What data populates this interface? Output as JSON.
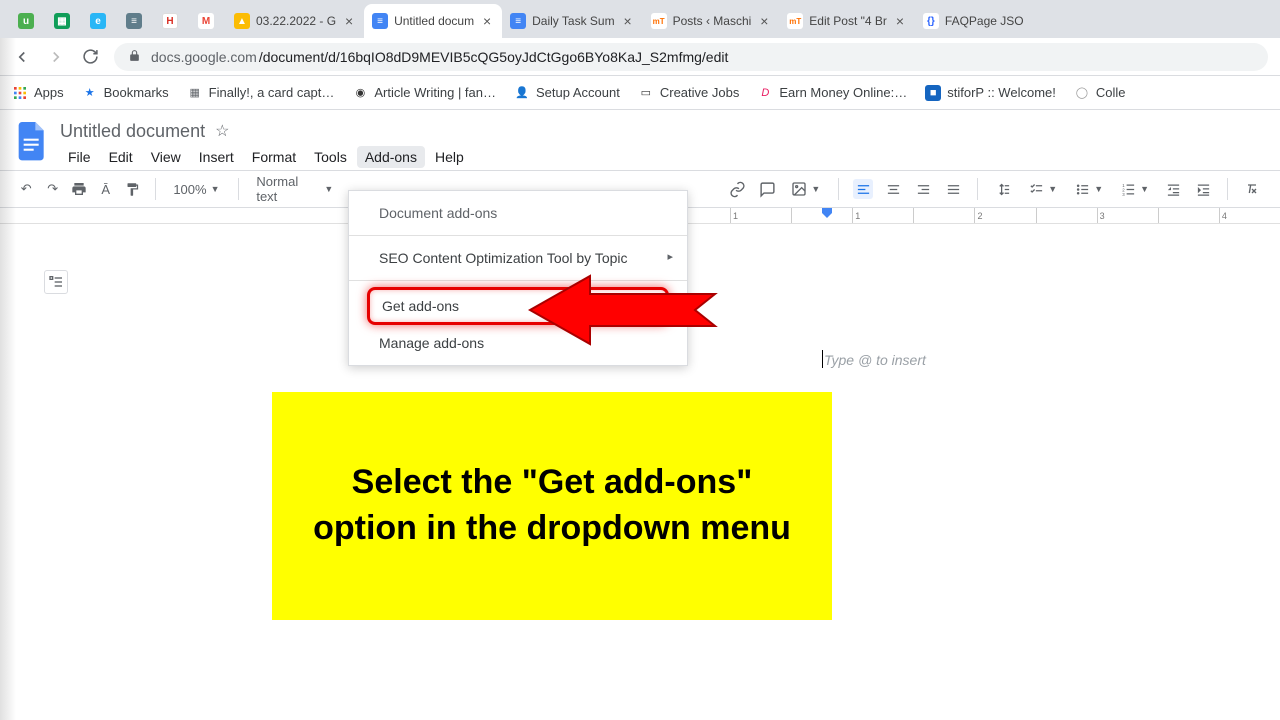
{
  "browser": {
    "tabs": [
      {
        "label": "",
        "color": "#4caf50"
      },
      {
        "label": "",
        "color": "#0f9d58"
      },
      {
        "label": "",
        "color": "#29b6f6"
      },
      {
        "label": "",
        "color": "#607d8b"
      },
      {
        "label": "",
        "color": "#d93025"
      },
      {
        "label": "",
        "color": "#ea4335"
      },
      {
        "label": "03.22.2022 - G",
        "color": "#fbbc04"
      },
      {
        "label": "Untitled docum",
        "color": "#4285f4",
        "active": true
      },
      {
        "label": "Daily Task Sum",
        "color": "#4285f4"
      },
      {
        "label": "Posts ‹ Maschi",
        "color": "#ff6f00"
      },
      {
        "label": "Edit Post \"4 Br",
        "color": "#ff6f00"
      },
      {
        "label": "FAQPage JSO",
        "color": "#2962ff"
      }
    ],
    "url_host": "docs.google.com",
    "url_path": "/document/d/16bqIO8dD9MEVIB5cQG5oyJdCtGgo6BYo8KaJ_S2mfmg/edit",
    "bookmarks": {
      "apps": "Apps",
      "items": [
        {
          "label": "Bookmarks",
          "icon": "★",
          "iconcolor": "#1a73e8"
        },
        {
          "label": "Finally!, a card capt…",
          "icon": "▦",
          "iconcolor": "#5f6368"
        },
        {
          "label": "Article Writing | fan…",
          "icon": "◉",
          "iconcolor": "#333"
        },
        {
          "label": "Setup Account",
          "icon": "◆",
          "iconcolor": "#f4511e"
        },
        {
          "label": "Creative Jobs",
          "icon": "▭",
          "iconcolor": "#333"
        },
        {
          "label": "Earn Money Online:…",
          "icon": "D",
          "iconcolor": "#e91e63"
        },
        {
          "label": "stiforP :: Welcome!",
          "icon": "■",
          "iconcolor": "#1565c0"
        },
        {
          "label": "Colle",
          "icon": "◯",
          "iconcolor": "#999"
        }
      ]
    }
  },
  "docs": {
    "title": "Untitled document",
    "menus": [
      "File",
      "Edit",
      "View",
      "Insert",
      "Format",
      "Tools",
      "Add-ons",
      "Help"
    ],
    "active_menu": "Add-ons",
    "toolbar": {
      "zoom": "100%",
      "style": "Normal text"
    },
    "placeholder": "Type @ to insert",
    "ruler": [
      "1",
      "",
      "1",
      "",
      "2",
      "",
      "3",
      "",
      "4"
    ]
  },
  "dropdown": {
    "header": "Document add-ons",
    "submenu": "SEO Content Optimization Tool by Topic",
    "get": "Get add-ons",
    "manage": "Manage add-ons"
  },
  "annotation": {
    "callout": "Select the \"Get add-ons\" option in the dropdown menu"
  }
}
